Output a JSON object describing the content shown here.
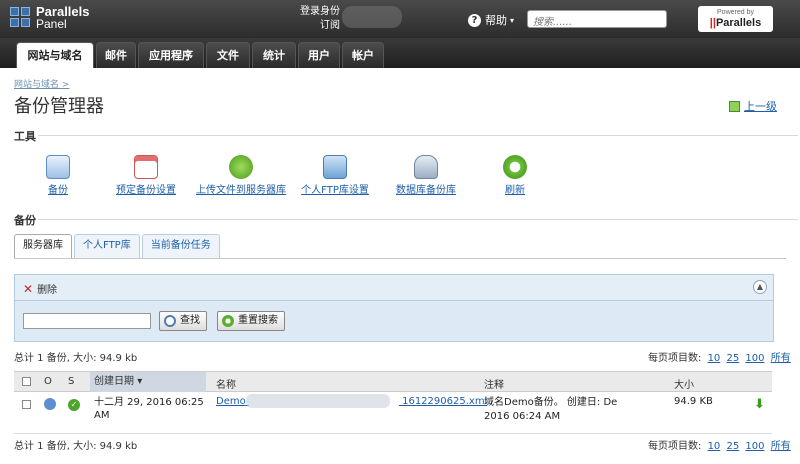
{
  "header": {
    "logo_line1": "Parallels",
    "logo_line2": "Panel",
    "login_label": "登录身份",
    "subscription_label": "订阅",
    "help_label": "帮助",
    "search_placeholder": "搜索......",
    "powered_small": "Powered by",
    "powered_brand": "Parallels"
  },
  "nav": {
    "tabs": [
      {
        "label": "网站与域名"
      },
      {
        "label": "邮件"
      },
      {
        "label": "应用程序"
      },
      {
        "label": "文件"
      },
      {
        "label": "统计"
      },
      {
        "label": "用户"
      },
      {
        "label": "帐户"
      }
    ]
  },
  "page": {
    "breadcrumb": "网站与域名",
    "breadcrumb_sep": ">",
    "title": "备份管理器",
    "up_level": "上一级"
  },
  "tools": {
    "section_label": "工具",
    "items": [
      {
        "label": "备份",
        "icon": "backup-icon"
      },
      {
        "label": "预定备份设置",
        "icon": "schedule-icon"
      },
      {
        "label": "上传文件到服务器库",
        "icon": "upload-icon"
      },
      {
        "label": "个人FTP库设置",
        "icon": "ftp-icon"
      },
      {
        "label": "数据库备份库",
        "icon": "database-icon"
      },
      {
        "label": "刷新",
        "icon": "refresh-icon"
      }
    ]
  },
  "backup": {
    "section_label": "备份",
    "tabs": [
      {
        "label": "服务器库"
      },
      {
        "label": "个人FTP库"
      },
      {
        "label": "当前备份任务"
      }
    ],
    "delete_label": "删除",
    "search_button": "查找",
    "reset_button": "重置搜索",
    "summary": "总计 1 备份, 大小: 94.9 kb",
    "per_page_label": "每页项目数:",
    "per_page_options": [
      "10",
      "25",
      "100",
      "所有"
    ]
  },
  "table": {
    "headers": {
      "o": "O",
      "s": "S",
      "created": "创建日期",
      "name": "名称",
      "comment": "注释",
      "size": "大小"
    },
    "rows": [
      {
        "created_line1": "十二月 29, 2016 06:25",
        "created_line2": "AM",
        "name_prefix": "Demo",
        "name_suffix": "1612290625.xml",
        "comment_line1": "域名Demo备份。 创建日: De",
        "comment_line2": "2016 06:24 AM",
        "size": "94.9 KB"
      }
    ]
  }
}
